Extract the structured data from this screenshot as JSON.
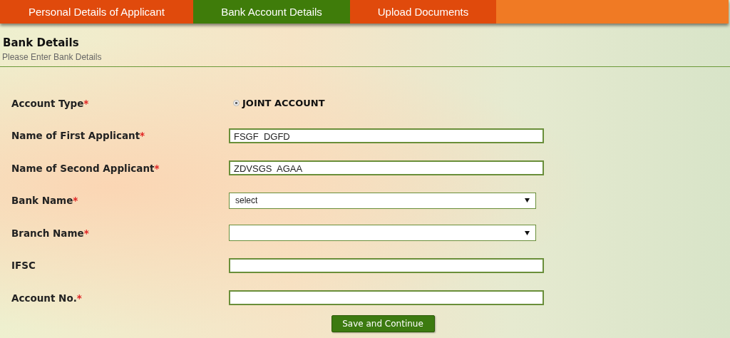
{
  "tabs": [
    {
      "label": "Personal Details of Applicant",
      "selected": false
    },
    {
      "label": "Bank Account Details",
      "selected": true
    },
    {
      "label": "Upload Documents",
      "selected": false
    }
  ],
  "section": {
    "title": "Bank Details",
    "subtitle": "Please Enter Bank Details"
  },
  "fields": [
    {
      "kind": "radio",
      "label": "Account Type",
      "mark": "*",
      "option": "JOINT ACCOUNT",
      "checked": true
    },
    {
      "kind": "text",
      "label": "Name of First Applicant",
      "mark": "*",
      "value": "FSGF  DGFD"
    },
    {
      "kind": "text",
      "label": "Name of Second Applicant",
      "mark": "*",
      "value": "ZDVSGS  AGAA"
    },
    {
      "kind": "select",
      "label": "Bank Name",
      "mark": "*",
      "value": "select"
    },
    {
      "kind": "select",
      "label": "Branch Name",
      "mark": "*"
    },
    {
      "kind": "text",
      "label": "IFSC"
    },
    {
      "kind": "text",
      "label": "Account No.",
      "mark": "*"
    }
  ],
  "submit": "Save and Continue"
}
